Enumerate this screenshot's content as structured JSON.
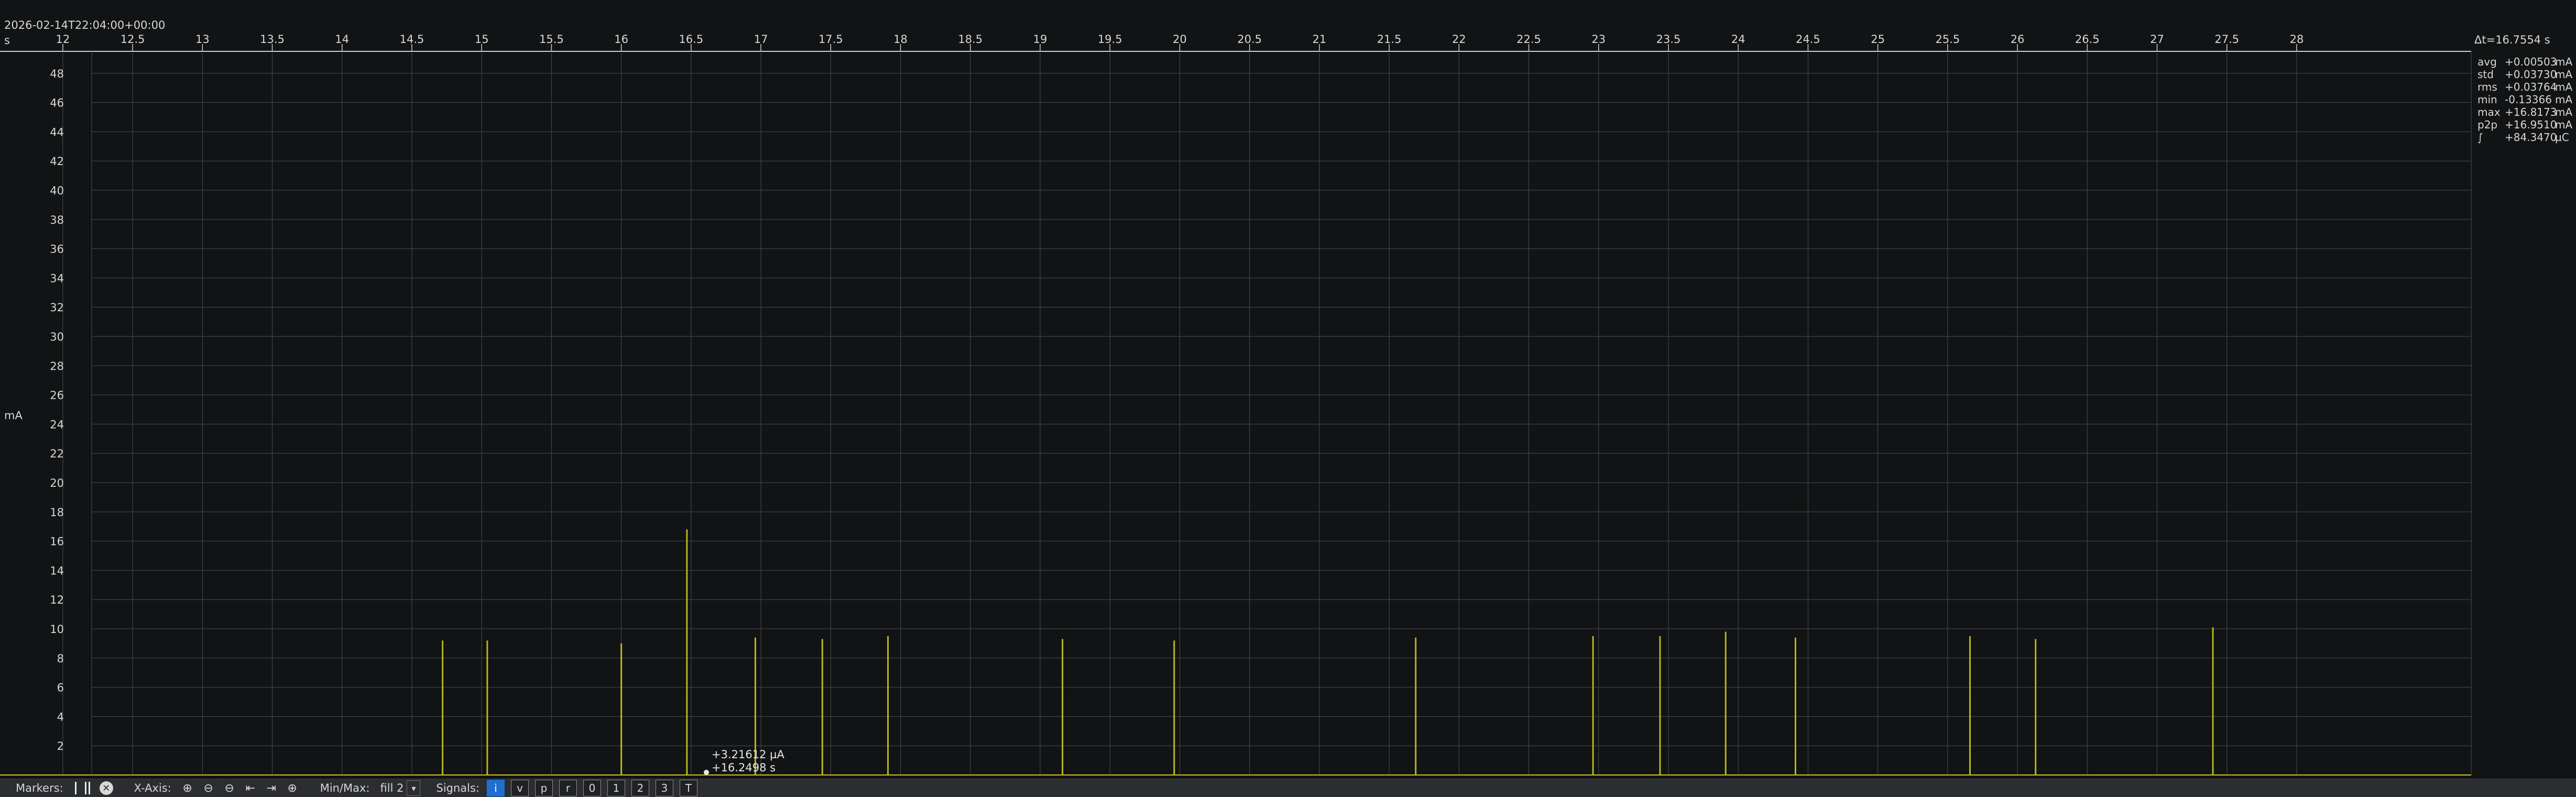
{
  "header": {
    "timestamp": "2026-02-14T22:04:00+00:00",
    "x_unit": "s",
    "delta_t": "Δt=16.7554 s"
  },
  "y_unit": "mA",
  "marker": {
    "value": "+3.21612 µA",
    "time": "+16.2498 s"
  },
  "stats": [
    {
      "name": "avg",
      "value": "+0.00503",
      "unit": "mA"
    },
    {
      "name": "std",
      "value": "+0.03730",
      "unit": "mA"
    },
    {
      "name": "rms",
      "value": "+0.03764",
      "unit": "mA"
    },
    {
      "name": "min",
      "value": "-0.13366",
      "unit": "mA"
    },
    {
      "name": "max",
      "value": "+16.8173",
      "unit": "mA"
    },
    {
      "name": "p2p",
      "value": "+16.9510",
      "unit": "mA"
    },
    {
      "name": "∫",
      "value": "+84.3470",
      "unit": "µC"
    }
  ],
  "toolbar": {
    "markers_label": "Markers:",
    "xaxis_label": "X-Axis:",
    "minmax_label": "Min/Max:",
    "minmax_value": "fill 2",
    "signals_label": "Signals:",
    "signals": [
      "i",
      "v",
      "p",
      "r",
      "0",
      "1",
      "2",
      "3",
      "T"
    ],
    "active_signal": "i"
  },
  "colors": {
    "background": "#121314",
    "grid": "#4a4c50",
    "trace": "#c8c81e",
    "toolbar": "#2b2d30",
    "active": "#1f6fd1"
  },
  "chart_data": {
    "type": "line",
    "title": "",
    "xlabel": "s",
    "ylabel": "mA",
    "xlim": [
      11.55,
      29.25
    ],
    "ylim": [
      0,
      49.5
    ],
    "x_ticks": [
      12,
      12.5,
      13,
      13.5,
      14,
      14.5,
      15,
      15.5,
      16,
      16.5,
      17,
      17.5,
      18,
      18.5,
      19,
      19.5,
      20,
      20.5,
      21,
      21.5,
      22,
      22.5,
      23,
      23.5,
      24,
      24.5,
      25,
      25.5,
      26,
      26.5,
      27,
      27.5,
      28
    ],
    "y_ticks": [
      2,
      4,
      6,
      8,
      10,
      12,
      14,
      16,
      18,
      20,
      22,
      24,
      26,
      28,
      30,
      32,
      34,
      36,
      38,
      40,
      42,
      44,
      46,
      48
    ],
    "grid": true,
    "baseline": 0.0,
    "series": [
      {
        "values": [
          {
            "x": 14.72,
            "y": 9.2
          },
          {
            "x": 15.04,
            "y": 9.2
          },
          {
            "x": 16.0,
            "y": 9.0
          },
          {
            "x": 16.47,
            "y": 16.8
          },
          {
            "x": 16.96,
            "y": 9.4
          },
          {
            "x": 17.44,
            "y": 9.3
          },
          {
            "x": 17.91,
            "y": 9.5
          },
          {
            "x": 19.16,
            "y": 9.3
          },
          {
            "x": 19.96,
            "y": 9.2
          },
          {
            "x": 21.69,
            "y": 9.4
          },
          {
            "x": 22.96,
            "y": 9.5
          },
          {
            "x": 23.44,
            "y": 9.5
          },
          {
            "x": 23.91,
            "y": 9.8
          },
          {
            "x": 24.41,
            "y": 9.4
          },
          {
            "x": 25.66,
            "y": 9.5
          },
          {
            "x": 26.13,
            "y": 9.3
          },
          {
            "x": 27.4,
            "y": 10.1
          }
        ]
      }
    ]
  }
}
